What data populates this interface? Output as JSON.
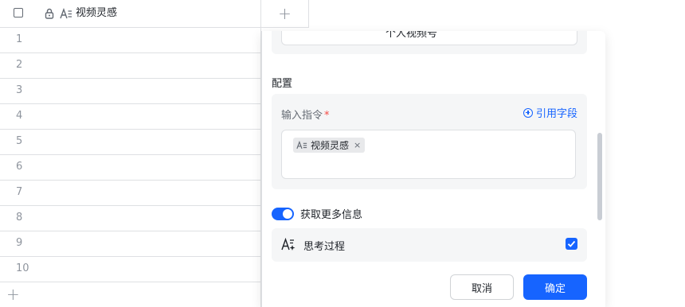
{
  "grid": {
    "column_title": "视频灵感",
    "add_column": "+",
    "add_row": "+",
    "row_numbers": [
      "1",
      "2",
      "3",
      "4",
      "5",
      "6",
      "7",
      "8",
      "9",
      "10"
    ]
  },
  "panel": {
    "top_input_partial": "个人视频号",
    "section_title": "配置",
    "instruction_label": "输入指令",
    "required_mark": "*",
    "cite_field": "引用字段",
    "chip_label": "视频灵感",
    "chip_close": "×",
    "toggle_label": "获取更多信息",
    "toggle_on": true,
    "thinking_label": "思考过程",
    "thinking_checked": true,
    "cancel": "取消",
    "confirm": "确定"
  },
  "colors": {
    "accent": "#1664ff",
    "required": "#f54a45",
    "section_bg": "#f5f6f7"
  }
}
